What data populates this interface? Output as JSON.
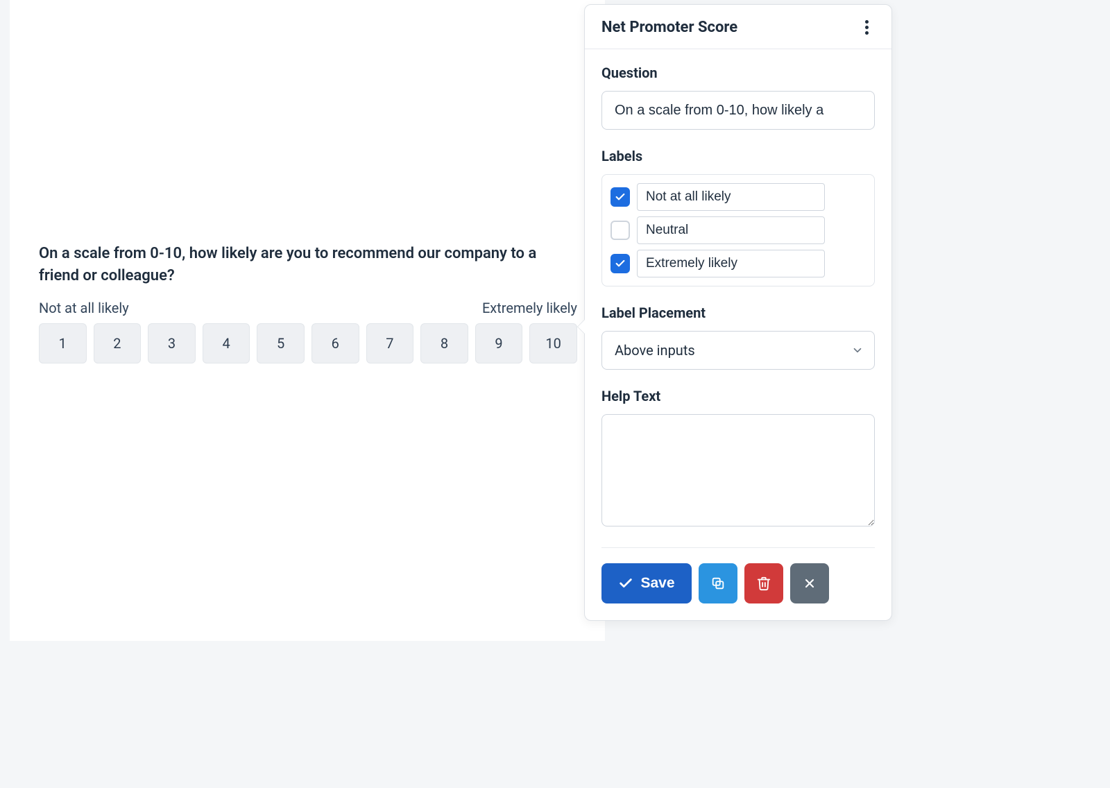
{
  "preview": {
    "question": "On a scale from 0-10, how likely are you to recommend our company to a friend or colleague?",
    "left_label": "Not at all likely",
    "right_label": "Extremely likely",
    "options": [
      "1",
      "2",
      "3",
      "4",
      "5",
      "6",
      "7",
      "8",
      "9",
      "10"
    ]
  },
  "panel": {
    "title": "Net Promoter Score",
    "question_section": "Question",
    "question_value": "On a scale from 0-10, how likely a",
    "labels_section": "Labels",
    "labels": [
      {
        "checked": true,
        "value": "Not at all likely"
      },
      {
        "checked": false,
        "value": "Neutral"
      },
      {
        "checked": true,
        "value": "Extremely likely"
      }
    ],
    "placement_section": "Label Placement",
    "placement_value": "Above inputs",
    "help_section": "Help Text",
    "help_value": "",
    "save_label": "Save"
  },
  "colors": {
    "primary": "#1d61c6",
    "info": "#2b94e0",
    "danger": "#d13a3a",
    "muted": "#5f6c78",
    "checkbox": "#1d6de0"
  }
}
